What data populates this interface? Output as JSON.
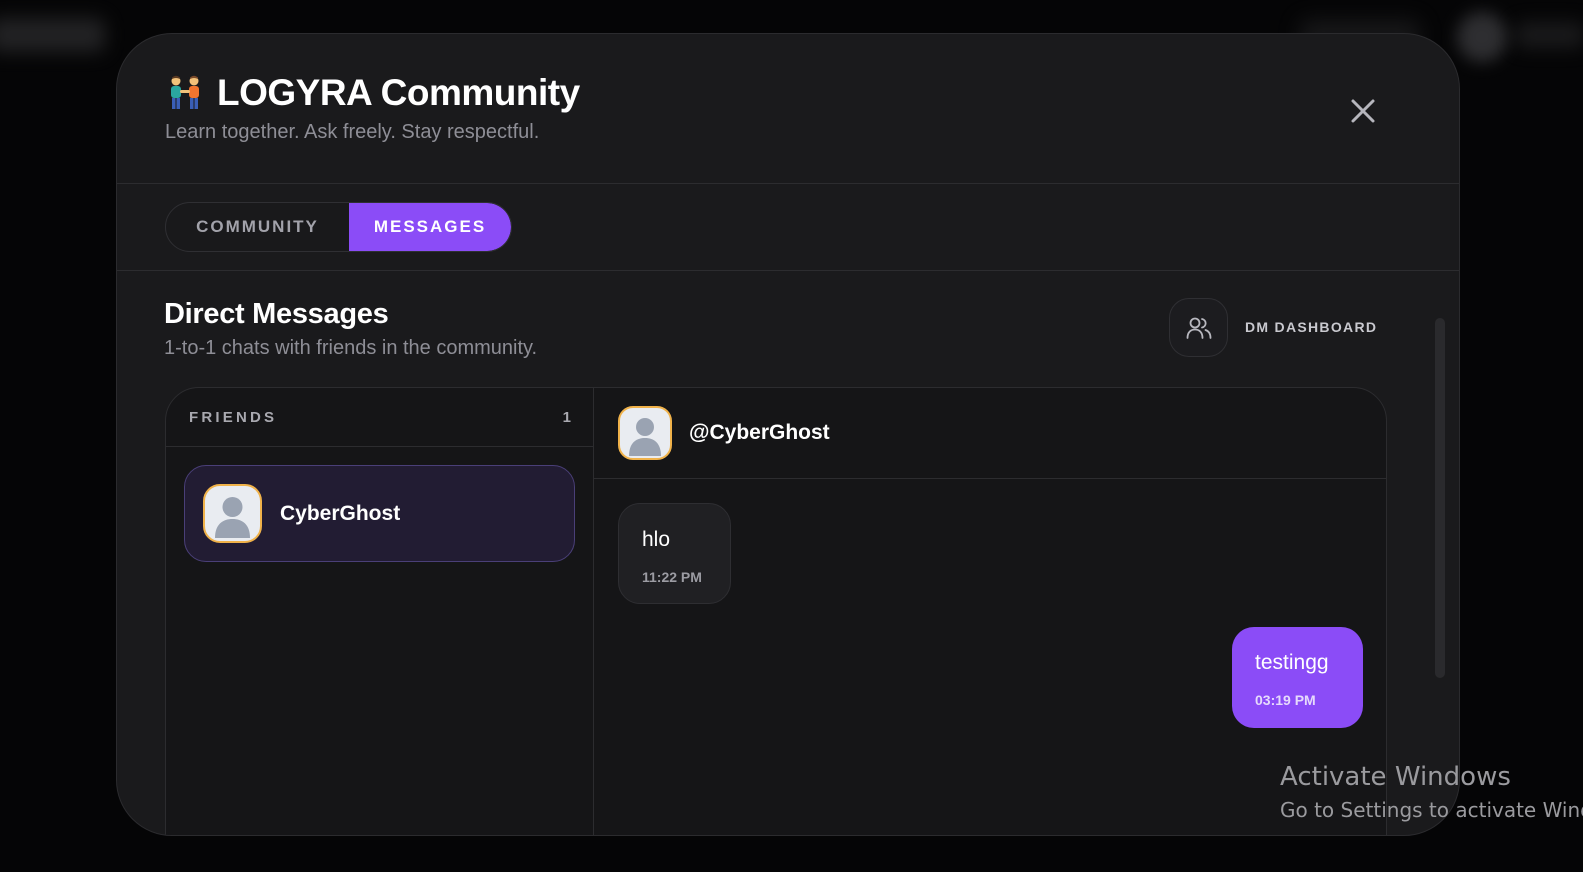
{
  "modal": {
    "title": "LOGYRA Community",
    "subtitle": "Learn together. Ask freely. Stay respectful.",
    "title_icon": "people-holding-hands-icon",
    "close_icon": "close-icon"
  },
  "tabs": [
    {
      "label": "COMMUNITY",
      "active": false
    },
    {
      "label": "MESSAGES",
      "active": true
    }
  ],
  "dm": {
    "title": "Direct Messages",
    "subtitle": "1-to-1 chats with friends in the community.",
    "dashboard_label": "DM DASHBOARD",
    "dashboard_icon": "users-icon"
  },
  "friends": {
    "label": "FRIENDS",
    "count": "1",
    "items": [
      {
        "name": "CyberGhost",
        "selected": true
      }
    ]
  },
  "chat": {
    "handle": "@CyberGhost",
    "messages": [
      {
        "text": "hlo",
        "time": "11:22 PM",
        "direction": "incoming"
      },
      {
        "text": "testingg",
        "time": "03:19 PM",
        "direction": "outgoing"
      }
    ]
  },
  "watermark": {
    "title": "Activate Windows",
    "subtitle": "Go to Settings to activate Windows."
  },
  "colors": {
    "accent": "#8b4cf7",
    "avatar_border": "#f0b24a",
    "modal_bg": "#1a1a1c",
    "page_bg": "#050506"
  }
}
